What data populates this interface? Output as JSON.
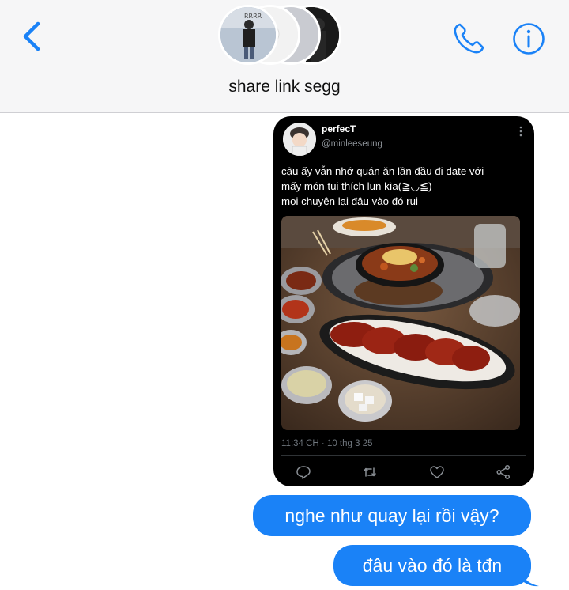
{
  "header": {
    "group_name": "share link segg",
    "accent": "#1a82f7"
  },
  "tweet": {
    "display_name": "perfecT",
    "handle": "@minleeseung",
    "text_lines": [
      "cậu ấy vẫn nhớ quán ăn lần đầu đi date với",
      "mấy món tui thích lun kìa(≧◡≦)",
      "mọi chuyện lại đâu vào đó rui"
    ],
    "timestamp": "11:34 CH · 10 thg 3 25"
  },
  "messages": [
    {
      "text": "nghe như quay lại rồi vậy?"
    },
    {
      "text": "đâu vào đó là tđn"
    }
  ],
  "icons": [
    "back-chevron-icon",
    "phone-icon",
    "info-icon",
    "reply-icon",
    "retweet-icon",
    "like-icon",
    "share-icon",
    "more-icon"
  ]
}
